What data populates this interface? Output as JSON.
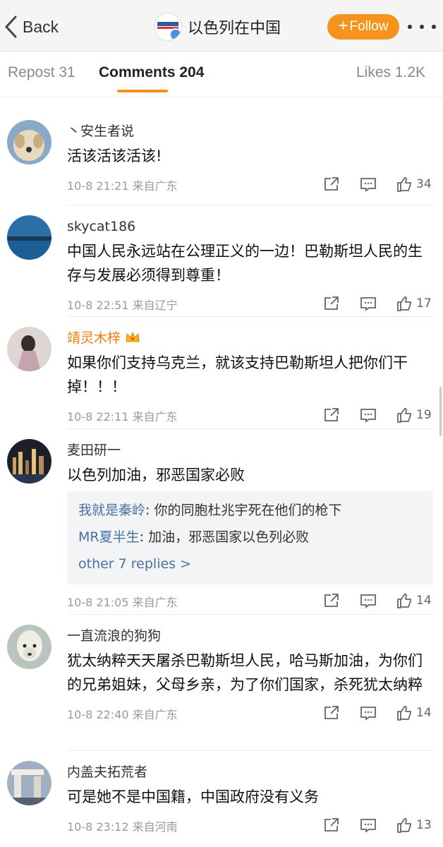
{
  "nav": {
    "back_label": "Back",
    "title": "以色列在中国",
    "follow_label": "Follow",
    "accent_color": "#f6931c"
  },
  "tabs": {
    "repost": "Repost 31",
    "comments": "Comments 204",
    "likes": "Likes 1.2K"
  },
  "comments": [
    {
      "user": "丶安生者说",
      "text": "活该活该活该!",
      "time": "10-8 21:21",
      "location": "来自广东",
      "likes": "34",
      "avatar": "dog-avatar"
    },
    {
      "user": "skycat186",
      "text": "中国人民永远站在公理正义的一边！巴勒斯坦人民的生存与发展必须得到尊重！",
      "time": "10-8 22:51",
      "location": "来自辽宁",
      "likes": "17",
      "avatar": "lake-avatar"
    },
    {
      "user": "靖灵木梓",
      "text": "如果你们支持乌克兰，就该支持巴勒斯坦人把你们干掉！！！",
      "time": "10-8 22:11",
      "location": "来自广东",
      "likes": "19",
      "avatar": "person-avatar",
      "vip": true
    },
    {
      "user": "麦田研一",
      "text": "以色列加油，邪恶国家必败",
      "time": "10-8 21:05",
      "location": "来自广东",
      "likes": "14",
      "avatar": "city-night-avatar",
      "replies": [
        {
          "user": "我就是秦岭",
          "text": "你的同胞杜兆宇死在他们的枪下"
        },
        {
          "user": "MR夏半生",
          "text": "加油，邪恶国家以色列必败"
        }
      ],
      "more_replies": "other 7 replies >"
    },
    {
      "user": "一直流浪的狗狗",
      "text": "犹太纳粹天天屠杀巴勒斯坦人民，哈马斯加油，为你们的兄弟姐妹，父母乡亲，为了你们国家，杀死犹太纳粹",
      "time": "10-8 22:40",
      "location": "来自广东",
      "likes": "14",
      "avatar": "alpaca-avatar"
    },
    {
      "user": "内盖夫拓荒者",
      "text": "可是她不是中国籍，中国政府没有义务",
      "time": "10-8 23:12",
      "location": "来自河南",
      "likes": "13",
      "avatar": "monument-avatar"
    }
  ]
}
